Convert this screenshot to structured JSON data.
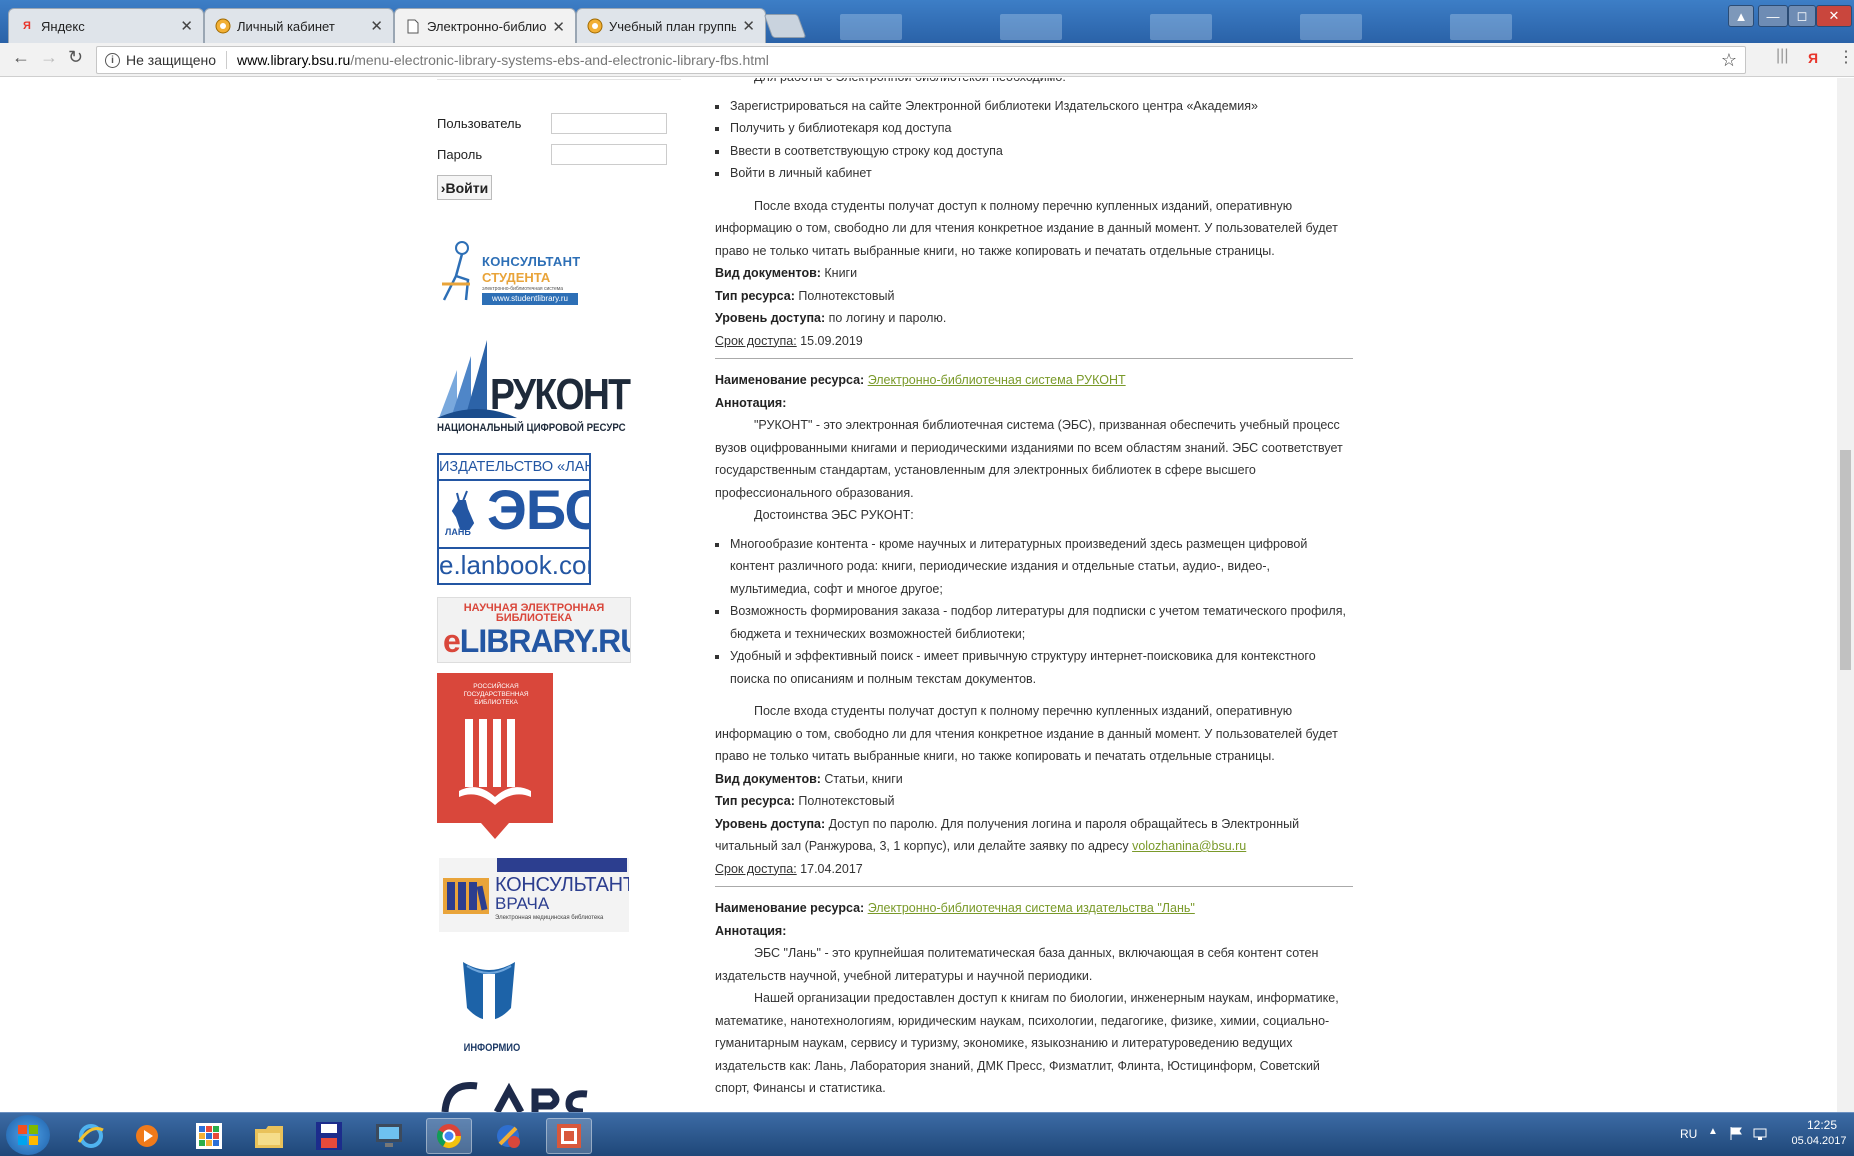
{
  "browser": {
    "tabs": [
      {
        "title": "Яндекс",
        "icon": "yandex-icon",
        "active": false
      },
      {
        "title": "Личный кабинет",
        "icon": "bsu-icon",
        "active": false
      },
      {
        "title": "Электронно-библиоте",
        "icon": "page-icon",
        "active": true
      },
      {
        "title": "Учебный план группы (",
        "icon": "bsu-icon",
        "active": false
      }
    ],
    "tab_close": "✕",
    "security_label": "Не защищено",
    "url_host": "www.library.bsu.ru",
    "url_path": "/menu-electronic-library-systems-ebs-and-electronic-library-fbs.html",
    "yandex_letter": "Я"
  },
  "sidebar": {
    "user_label": "Пользователь",
    "password_label": "Пароль",
    "login_button": "›Войти",
    "banners": {
      "konsultant_student": {
        "line1": "КОНСУЛЬТАНТ",
        "line2": "СТУДЕНТА",
        "line3": "электронно-библиотечная система",
        "url": "www.studentlibrary.ru"
      },
      "rukont": {
        "name": "РУКОНТ",
        "sub": "НАЦИОНАЛЬНЫЙ ЦИФРОВОЙ РЕСУРС"
      },
      "lan": {
        "top": "ИЗДАТЕЛЬСТВО «ЛАНЬ»",
        "ebs": "ЭБС",
        "mark": "ЛАНЬ",
        "url": "e.lanbook.com"
      },
      "elibrary": {
        "top1": "НАУЧНАЯ ЭЛЕКТРОННАЯ",
        "top2": "БИБЛИОТЕКА",
        "name_e": "e",
        "name": "LIBRARY",
        "ru": ".RU"
      },
      "rgb": {
        "line1": "РОССИЙСКАЯ",
        "line2": "ГОСУДАРСТВЕННАЯ",
        "line3": "БИБЛИОТЕКА"
      },
      "konsultant_vracha": {
        "line1": "КОНСУЛЬТАНТ",
        "line2": "ВРАЧА",
        "line3": "Электронная медицинская библиотека"
      },
      "informio": {
        "name": "ИНФОРМИО"
      }
    }
  },
  "main": {
    "s1": {
      "intro": "Для работы с Электронной библиотекой необходимо:",
      "steps": [
        "Зарегистрироваться на сайте Электронной библиотеки Издательского центра «Академия»",
        "Получить у библиотекаря код доступа",
        "Ввести в соответствующую строку код доступа",
        "Войти в личный кабинет"
      ],
      "after": "После входа студенты получат доступ к полному перечню купленных изданий, оперативную информацию о том, свободно ли для чтения конкретное издание в данный момент. У пользователей будет право не только читать выбранные книги, но также копировать и печатать отдельные страницы.",
      "doc_label": "Вид документов:",
      "doc_value": " Книги",
      "type_label": "Тип ресурса:",
      "type_value": " Полнотекстовый",
      "level_label": "Уровень доступа:",
      "level_value": " по логину и паролю.",
      "term_label": "Срок доступа:",
      "term_value": " 15.09.2019"
    },
    "s2": {
      "name_label": "Наименование ресурса:",
      "name_link": "Электронно-библиотечная система РУКОНТ",
      "ann_label": "Аннотация:",
      "ann_text": "\"РУКОНТ\" - это электронная библиотечная система (ЭБС), призванная обеспечить учебный процесс вузов оцифрованными книгами и периодическими изданиями по всем областям знаний. ЭБС соответствует государственным стандартам, установленным для электронных библиотек в сфере высшего профессионального образования.",
      "adv_title": "Достоинства ЭБС РУКОНТ:",
      "adv": [
        "Многообразие контента - кроме научных и литературных произведений здесь размещен цифровой контент различного рода: книги, периодические издания и отдельные статьи, аудио-, видео-, мультимедиа, софт и многое другое;",
        "Возможность формирования заказа - подбор литературы для подписки с учетом тематического профиля, бюджета и технических возможностей библиотеки;",
        "Удобный и эффективный поиск - имеет привычную структуру интернет-поисковика для контекстного поиска по описаниям и полным текстам документов."
      ],
      "after": "После входа студенты получат доступ к полному перечню купленных изданий, оперативную информацию о том, свободно ли для чтения конкретное издание в данный момент. У пользователей будет право не только читать выбранные книги, но также копировать и печатать отдельные страницы.",
      "doc_label": "Вид документов:",
      "doc_value": " Статьи, книги",
      "type_label": "Тип ресурса:",
      "type_value": " Полнотекстовый",
      "level_label": "Уровень доступа:",
      "level_value": " Доступ по паролю. Для получения логина и пароля обращайтесь в Электронный читальный зал (Ранжурова, 3, 1 корпус), или делайте заявку по адресу ",
      "email": "volozhanina@bsu.ru",
      "term_label": "Срок доступа:",
      "term_value": " 17.04.2017"
    },
    "s3": {
      "name_label": "Наименование ресурса:",
      "name_link": "Электронно-библиотечная система издательства \"Лань\"",
      "ann_label": "Аннотация:",
      "ann_text": "ЭБС \"Лань\" - это крупнейшая политематическая база данных, включающая в себя контент сотен издательств научной, учебной литературы и научной периодики.",
      "access_text": "Нашей организации предоставлен доступ к книгам по биологии, инженерным наукам, информатике, математике, нанотехнологиям, юридическим наукам, психологии, педагогике, физике, химии, социально-гуманитарным наукам, сервису и туризму, экономике, языкознанию и литературоведению ведущих издательств как: Лань, Лаборатория знаний, ДМК Пресс, Физматлит, Флинта, Юстицинформ, Советский спорт, Финансы и статистика."
    }
  },
  "taskbar": {
    "lang": "RU",
    "time": "12:25",
    "date": "05.04.2017",
    "apps": [
      "windows-start-icon",
      "ie-icon",
      "media-player-icon",
      "tiles-icon",
      "explorer-icon",
      "floppy-icon",
      "monitor-icon",
      "chrome-icon",
      "plus-icon",
      "presentation-icon"
    ]
  },
  "colors": {
    "link": "#7a9a2a",
    "tab_strip": "#2f6db3",
    "taskbar": "#2b5a93",
    "rgb_red": "#d9473b",
    "lan_blue": "#2356a3"
  }
}
